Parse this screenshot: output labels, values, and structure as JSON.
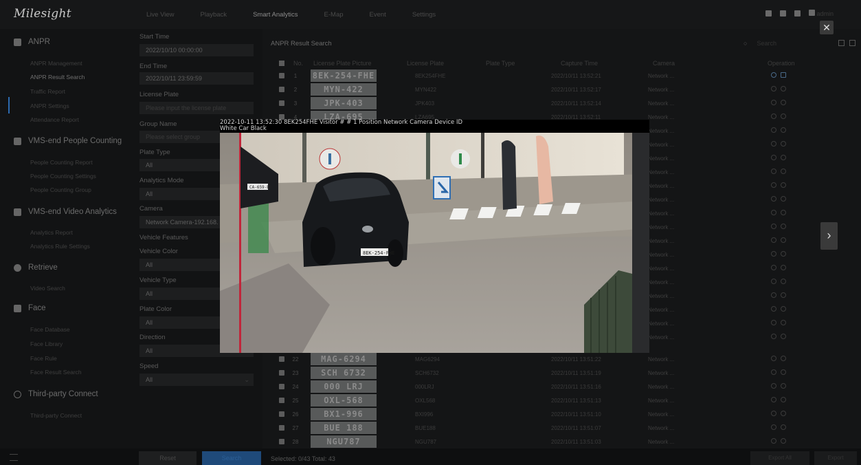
{
  "app": {
    "logo": "Milesight",
    "top_tabs": [
      "Live View",
      "Playback",
      "Smart Analytics",
      "E-Map",
      "Event",
      "Settings"
    ],
    "active_tab": "Smart Analytics",
    "user": "admin"
  },
  "sidebar": {
    "sections": [
      {
        "label": "ANPR",
        "icon": "car-icon",
        "items": [
          "ANPR Management",
          "ANPR Result Search",
          "Traffic Report",
          "ANPR Settings",
          "Attendance Report"
        ],
        "active_item": "ANPR Result Search"
      },
      {
        "label": "VMS-end People Counting",
        "icon": "people-icon",
        "items": [
          "People Counting Report",
          "People Counting Settings",
          "People Counting Group"
        ]
      },
      {
        "label": "VMS-end Video Analytics",
        "icon": "analytics-icon",
        "items": [
          "Analytics Report",
          "Analytics Rule Settings"
        ]
      },
      {
        "label": "Retrieve",
        "icon": "play-circle-icon",
        "items": [
          "Video Search"
        ]
      },
      {
        "label": "Face",
        "icon": "face-icon",
        "items": [
          "Face Database",
          "Face Library",
          "Face Rule",
          "Face Result Search"
        ]
      },
      {
        "label": "Third-party Connect",
        "icon": "link-icon",
        "items": [
          "Third-party Connect"
        ]
      }
    ]
  },
  "filters": {
    "start_time_label": "Start Time",
    "start_time": "2022/10/10 00:00:00",
    "end_time_label": "End Time",
    "end_time": "2022/10/11 23:59:59",
    "license_plate_label": "License Plate",
    "license_plate_placeholder": "Please input the license plate",
    "group_name_label": "Group Name",
    "group_name_placeholder": "Please select group",
    "plate_type_label": "Plate Type",
    "plate_type": "All",
    "analytics_mode_label": "Analytics Mode",
    "analytics_mode": "All",
    "camera_label": "Camera",
    "camera": "Network Camera-192.168.",
    "vehicle_features_label": "Vehicle Features",
    "vehicle_color_label": "Vehicle Color",
    "vehicle_color": "All",
    "vehicle_type_label": "Vehicle Type",
    "vehicle_type": "All",
    "plate_color_label": "Plate Color",
    "plate_color": "All",
    "direction_label": "Direction",
    "direction": "All",
    "speed_label": "Speed",
    "speed": "All",
    "reset_label": "Reset",
    "search_label": "Search"
  },
  "results": {
    "title": "ANPR Result Search",
    "search_placeholder": "Search",
    "columns": [
      "No.",
      "License Plate Picture",
      "License Plate",
      "Plate Type",
      "Capture Time",
      "Camera",
      "Operation"
    ],
    "rows": [
      {
        "no": "1",
        "plate_img": "8EK-254-FHE",
        "plate": "8EK254FHE",
        "time": "2022/10/11 13:52:21",
        "camera": "Network ..."
      },
      {
        "no": "2",
        "plate_img": "MYN-422",
        "plate": "MYN422",
        "time": "2022/10/11 13:52:17",
        "camera": "Network ..."
      },
      {
        "no": "3",
        "plate_img": "JPK-403",
        "plate": "JPK403",
        "time": "2022/10/11 13:52:14",
        "camera": "Network ..."
      },
      {
        "no": "4",
        "plate_img": "LZA-695",
        "plate": "LZA695",
        "time": "2022/10/11 13:52:11",
        "camera": "Network ..."
      },
      {
        "no": "22",
        "plate_img": "MAG-6294",
        "plate": "MAG6294",
        "time": "2022/10/11 13:51:22",
        "camera": "Network ..."
      },
      {
        "no": "23",
        "plate_img": "SCH 6732",
        "plate": "SCH6732",
        "time": "2022/10/11 13:51:19",
        "camera": "Network ..."
      },
      {
        "no": "24",
        "plate_img": "000 LRJ",
        "plate": "000LRJ",
        "time": "2022/10/11 13:51:16",
        "camera": "Network ..."
      },
      {
        "no": "25",
        "plate_img": "OXL-568",
        "plate": "OXL568",
        "time": "2022/10/11 13:51:13",
        "camera": "Network ..."
      },
      {
        "no": "26",
        "plate_img": "BX1-996",
        "plate": "BXI996",
        "time": "2022/10/11 13:51:10",
        "camera": "Network ..."
      },
      {
        "no": "27",
        "plate_img": "BUE 188",
        "plate": "BUE188",
        "time": "2022/10/11 13:51:07",
        "camera": "Network ..."
      },
      {
        "no": "28",
        "plate_img": "NGU787",
        "plate": "NGU787",
        "time": "2022/10/11 13:51:03",
        "camera": "Network ..."
      }
    ],
    "camera_cell": "Network ...",
    "selected_info": "Selected: 0/43  Total: 43",
    "export_all_label": "Export All",
    "export_label": "Export"
  },
  "popup": {
    "caption_line1": "2022-10-11 13:52:30 8EK254FHE Visitor # # 1 Position Network Camera Device ID",
    "caption_line2": "White Car Black",
    "car_plate": "8EK-254-FHE",
    "left_car_plate": "CA-659-BD",
    "close_icon": "close-icon",
    "next_icon": "chevron-right-icon"
  },
  "colors": {
    "accent": "#1f4a7a",
    "background": "#111213",
    "panel": "#141516"
  }
}
